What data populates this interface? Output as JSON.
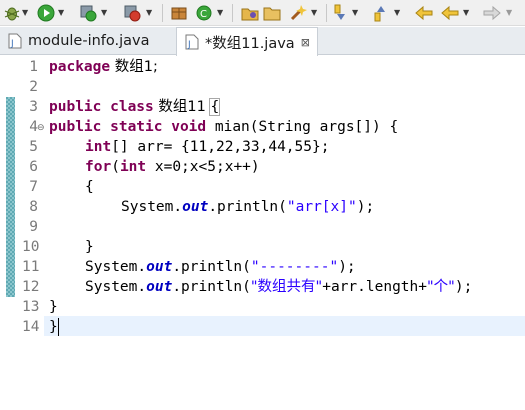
{
  "toolbar": {
    "buttons": [
      {
        "name": "debug-button",
        "icon": "bug-icon"
      },
      {
        "name": "run-button",
        "icon": "play-icon"
      },
      {
        "name": "run-config-button",
        "icon": "run-config-icon"
      },
      {
        "name": "external-tools-button",
        "icon": "external-tools-icon"
      },
      {
        "name": "new-package-button",
        "icon": "package-icon"
      },
      {
        "name": "new-class-button",
        "icon": "new-class-icon"
      },
      {
        "name": "open-type-button",
        "icon": "open-type-icon"
      },
      {
        "name": "open-folder-button",
        "icon": "folder-icon"
      },
      {
        "name": "task-button",
        "icon": "wand-icon"
      },
      {
        "name": "next-annotation-button",
        "icon": "down-arrow-icon"
      },
      {
        "name": "prev-annotation-button",
        "icon": "up-arrow-icon"
      },
      {
        "name": "last-edit-button",
        "icon": "last-edit-icon"
      },
      {
        "name": "back-button",
        "icon": "back-arrow-icon"
      },
      {
        "name": "forward-button",
        "icon": "forward-arrow-icon"
      }
    ]
  },
  "tabs": {
    "module_info": "module-info.java",
    "active": "*数组11.java",
    "close_glyph": "⊠"
  },
  "editor": {
    "line_numbers": [
      "1",
      "2",
      "3",
      "4",
      "5",
      "6",
      "7",
      "8",
      "9",
      "10",
      "11",
      "12",
      "13",
      "14"
    ],
    "lines": {
      "l1_kw": "package",
      "l1_rest": " 数组1;",
      "l3_kw": "public class",
      "l3_name": " 数组11 ",
      "l3_brace": "{",
      "l4_kw": "public static void",
      "l4_rest": " mian(String args[]) {",
      "l5_kw": "int",
      "l5_rest": "[] arr= {11,22,33,44,55};",
      "l6_kw1": "for",
      "l6_mid": "(",
      "l6_kw2": "int",
      "l6_rest": " x=0;x<5;x++)",
      "l7": "{",
      "l8_a": "System.",
      "l8_field": "out",
      "l8_b": ".println(",
      "l8_str": "\"arr[x]\"",
      "l8_c": ");",
      "l10": "}",
      "l11_a": "System.",
      "l11_field": "out",
      "l11_b": ".println(",
      "l11_str": "\"--------\"",
      "l11_c": ");",
      "l12_a": "System.",
      "l12_field": "out",
      "l12_b": ".println(",
      "l12_str1": "\"数组共有\"",
      "l12_mid": "+arr.length+",
      "l12_str2": "\"个\"",
      "l12_c": ");",
      "l13": "}",
      "l14": "}"
    }
  },
  "colors": {
    "keyword": "#7f0055",
    "string": "#2a00ff",
    "field": "#0000c0",
    "change_ruler": "#5fa9b3"
  }
}
